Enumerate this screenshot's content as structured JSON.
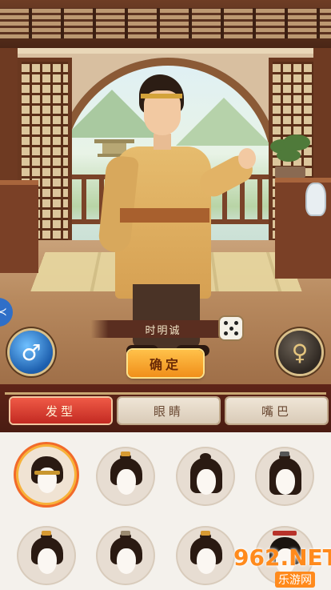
{
  "character": {
    "name": "时明诚"
  },
  "buttons": {
    "confirm_label": "确定",
    "male_symbol": "♂",
    "female_symbol": "♀",
    "side_tab_symbol": "≺"
  },
  "tabs": [
    {
      "label": "发型",
      "active": true
    },
    {
      "label": "眼睛",
      "active": false
    },
    {
      "label": "嘴巴",
      "active": false
    }
  ],
  "hairstyles": [
    {
      "id": "hair-1",
      "selected": true
    },
    {
      "id": "hair-2",
      "selected": false
    },
    {
      "id": "hair-3",
      "selected": false
    },
    {
      "id": "hair-4",
      "selected": false
    },
    {
      "id": "hair-5",
      "selected": false
    },
    {
      "id": "hair-6",
      "selected": false
    },
    {
      "id": "hair-7",
      "selected": false
    },
    {
      "id": "hair-8",
      "selected": false
    }
  ],
  "watermark": {
    "logo": "962.NET",
    "sub": "乐游网"
  },
  "colors": {
    "active_tab": "#d83a2c",
    "confirm": "#f5a228",
    "male": "#2f7fd8",
    "selected_ring": "#f26a2a"
  }
}
